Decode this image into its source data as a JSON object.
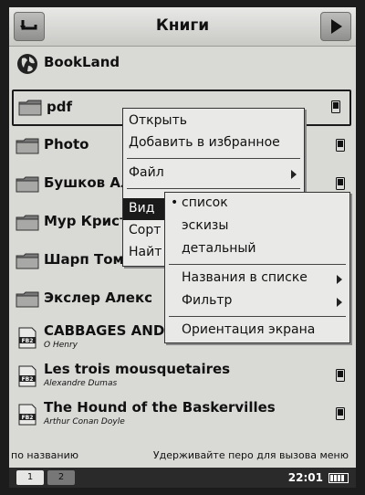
{
  "header": {
    "title": "Книги"
  },
  "list": [
    {
      "label": "BookLand",
      "icon": "globe-icon"
    },
    {
      "label": "pdf",
      "icon": "folder-icon",
      "device": true,
      "selected": true
    },
    {
      "label": "Photo",
      "icon": "folder-icon",
      "device": true
    },
    {
      "label": "Бушков Ал",
      "icon": "folder-icon",
      "device": true
    },
    {
      "label": "Мур Кристо",
      "icon": "folder-icon",
      "device": false
    },
    {
      "label": "Шарп Том",
      "icon": "folder-icon",
      "device": false
    },
    {
      "label": "Экслер Алекс",
      "icon": "folder-icon",
      "device": false
    },
    {
      "label": "CABBAGES AND",
      "sub": "O Henry",
      "icon": "fb2-book-icon",
      "device": false
    },
    {
      "label": "Les trois mousquetaires",
      "sub": "Alexandre Dumas",
      "icon": "fb2-book-icon",
      "device": true
    },
    {
      "label": "The Hound of the Baskervilles",
      "sub": "Arthur Conan Doyle",
      "icon": "fb2-book-icon",
      "device": true
    }
  ],
  "context_menu": {
    "items": [
      "Открыть",
      "Добавить в избранное",
      "Файл",
      "Вид",
      "Сорт",
      "Найт"
    ],
    "active": "Вид"
  },
  "view_submenu": {
    "items": [
      "список",
      "эскизы",
      "детальный",
      "Названия в списке",
      "Фильтр",
      "Ориентация экрана"
    ],
    "selected": "список"
  },
  "footer": {
    "sort": "по названию",
    "hint": "Удерживайте перо для вызова меню",
    "tabs": [
      "1",
      "2"
    ],
    "time": "22:01"
  }
}
